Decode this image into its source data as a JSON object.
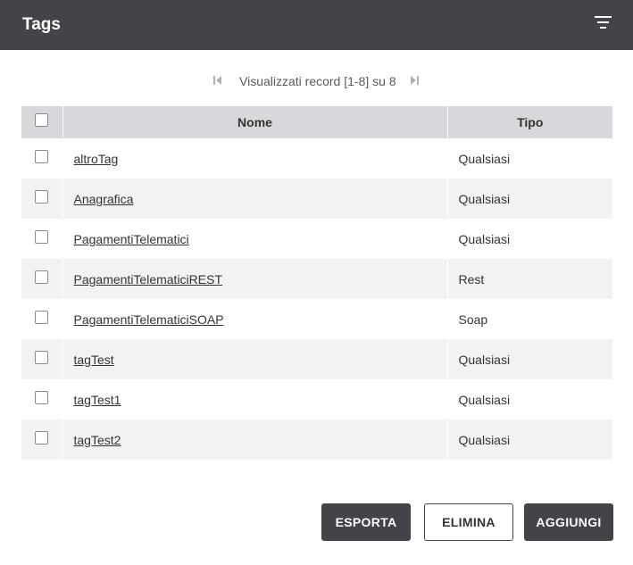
{
  "header": {
    "title": "Tags",
    "filter_icon": "filter-icon"
  },
  "pager": {
    "info": "Visualizzati record [1-8] su 8",
    "first_icon": "first-page-icon",
    "last_icon": "last-page-icon"
  },
  "table": {
    "columns": [
      "Nome",
      "Tipo"
    ],
    "rows": [
      {
        "nome": "altroTag",
        "tipo": "Qualsiasi"
      },
      {
        "nome": "Anagrafica",
        "tipo": "Qualsiasi"
      },
      {
        "nome": "PagamentiTelematici",
        "tipo": "Qualsiasi"
      },
      {
        "nome": "PagamentiTelematiciREST",
        "tipo": "Rest"
      },
      {
        "nome": "PagamentiTelematiciSOAP",
        "tipo": "Soap"
      },
      {
        "nome": "tagTest",
        "tipo": "Qualsiasi"
      },
      {
        "nome": "tagTest1",
        "tipo": "Qualsiasi"
      },
      {
        "nome": "tagTest2",
        "tipo": "Qualsiasi"
      }
    ]
  },
  "actions": {
    "esporta": "ESPORTA",
    "elimina": "ELIMINA",
    "aggiungi": "AGGIUNGI"
  },
  "colors": {
    "header_bg": "#434349",
    "table_header_bg": "#d8d8dc",
    "row_alt_bg": "#f2f2f3"
  }
}
